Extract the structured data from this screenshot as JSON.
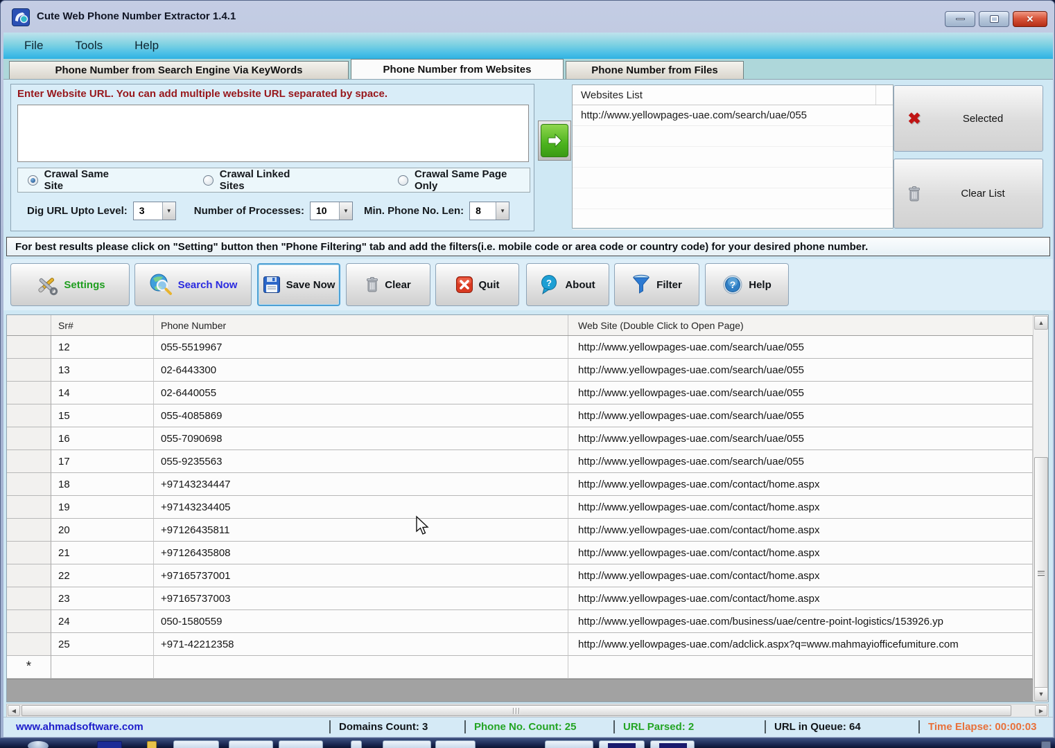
{
  "window": {
    "title": "Cute Web Phone Number Extractor 1.4.1"
  },
  "menu": {
    "items": [
      "File",
      "Tools",
      "Help"
    ]
  },
  "tabs": [
    {
      "label": "Phone Number from Search Engine Via KeyWords",
      "active": false
    },
    {
      "label": "Phone Number from Websites",
      "active": true
    },
    {
      "label": "Phone Number from Files",
      "active": false
    }
  ],
  "url_panel": {
    "label": "Enter Website URL. You can add multiple website URL separated by space.",
    "input_value": "",
    "radios": [
      {
        "label": "Crawal Same Site",
        "checked": true
      },
      {
        "label": "Crawal Linked Sites",
        "checked": false
      },
      {
        "label": "Crawal Same Page Only",
        "checked": false
      }
    ],
    "dig_url_label": "Dig URL Upto Level:",
    "dig_url_value": "3",
    "processes_label": "Number of Processes:",
    "processes_value": "10",
    "min_len_label": "Min. Phone No. Len:",
    "min_len_value": "8"
  },
  "websites_list": {
    "header": "Websites List",
    "items": [
      "http://www.yellowpages-uae.com/search/uae/055"
    ]
  },
  "side_buttons": {
    "selected_label": "Selected",
    "clear_list_label": "Clear List"
  },
  "info_bar": {
    "text": "For best results please click on \"Setting\" button then \"Phone Filtering\" tab and add the filters(i.e. mobile code or area code or country code) for your desired phone number."
  },
  "toolbar": {
    "buttons": [
      {
        "label": "Settings"
      },
      {
        "label": "Search Now"
      },
      {
        "label": "Save Now"
      },
      {
        "label": "Clear"
      },
      {
        "label": "Quit"
      },
      {
        "label": "About"
      },
      {
        "label": "Filter"
      },
      {
        "label": "Help"
      }
    ]
  },
  "grid": {
    "columns": {
      "sr": "Sr#",
      "phone": "Phone Number",
      "site": "Web Site (Double Click to Open Page)"
    },
    "rows": [
      {
        "sr": "12",
        "phone": "055-5519967",
        "site": "http://www.yellowpages-uae.com/search/uae/055"
      },
      {
        "sr": "13",
        "phone": "02-6443300",
        "site": "http://www.yellowpages-uae.com/search/uae/055"
      },
      {
        "sr": "14",
        "phone": "02-6440055",
        "site": "http://www.yellowpages-uae.com/search/uae/055"
      },
      {
        "sr": "15",
        "phone": "055-4085869",
        "site": "http://www.yellowpages-uae.com/search/uae/055"
      },
      {
        "sr": "16",
        "phone": "055-7090698",
        "site": "http://www.yellowpages-uae.com/search/uae/055"
      },
      {
        "sr": "17",
        "phone": "055-9235563",
        "site": "http://www.yellowpages-uae.com/search/uae/055"
      },
      {
        "sr": "18",
        "phone": "+97143234447",
        "site": "http://www.yellowpages-uae.com/contact/home.aspx"
      },
      {
        "sr": "19",
        "phone": "+97143234405",
        "site": "http://www.yellowpages-uae.com/contact/home.aspx"
      },
      {
        "sr": "20",
        "phone": "+97126435811",
        "site": "http://www.yellowpages-uae.com/contact/home.aspx"
      },
      {
        "sr": "21",
        "phone": "+97126435808",
        "site": "http://www.yellowpages-uae.com/contact/home.aspx"
      },
      {
        "sr": "22",
        "phone": "+97165737001",
        "site": "http://www.yellowpages-uae.com/contact/home.aspx"
      },
      {
        "sr": "23",
        "phone": "+97165737003",
        "site": "http://www.yellowpages-uae.com/contact/home.aspx"
      },
      {
        "sr": "24",
        "phone": "050-1580559",
        "site": "http://www.yellowpages-uae.com/business/uae/centre-point-logistics/153926.yp"
      },
      {
        "sr": "25",
        "phone": "+971-42212358",
        "site": "http://www.yellowpages-uae.com/adclick.aspx?q=www.mahmayiofficefumiture.com"
      }
    ],
    "new_row_marker": "*"
  },
  "status_bar": {
    "link": "www.ahmadsoftware.com",
    "domains": "Domains Count: 3",
    "phone_count": "Phone No. Count: 25",
    "url_parsed": "URL Parsed: 2",
    "url_queue": "URL in Queue: 64",
    "time_elapse": "Time Elapse: 00:00:03"
  },
  "colors": {
    "settings_green": "#1f9e1f",
    "search_blue": "#2a2ae0",
    "label_red": "#97171b",
    "status_green": "#23a423",
    "time_orange": "#e8703a",
    "link_blue": "#1c1cca"
  }
}
